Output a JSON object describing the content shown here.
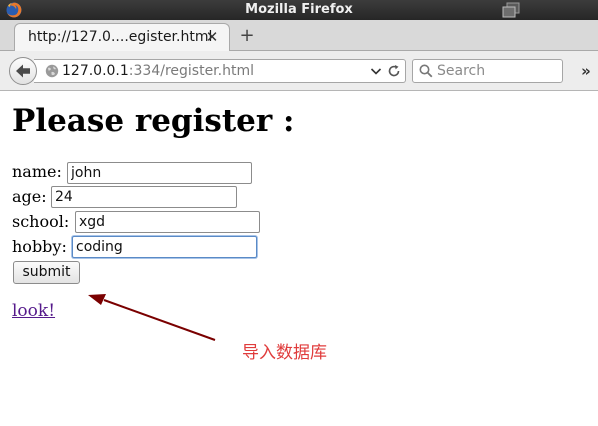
{
  "window": {
    "title": "Mozilla Firefox"
  },
  "tab": {
    "label": "http://127.0....egister.html",
    "close_glyph": "✕",
    "new_tab_glyph": "+"
  },
  "navbar": {
    "url_host": "127.0.0.1",
    "url_rest": ":334/register.html",
    "search_placeholder": "Search",
    "overflow_glyph": "»"
  },
  "page": {
    "heading": "Please register :",
    "form": {
      "name": {
        "label": "name:",
        "value": "john"
      },
      "age": {
        "label": "age:",
        "value": "24"
      },
      "school": {
        "label": "school:",
        "value": "xgd"
      },
      "hobby": {
        "label": "hobby:",
        "value": "coding"
      },
      "submit_label": "submit"
    },
    "link": "look!",
    "annotation": {
      "text": "导入数据库",
      "color": "#e03c3c",
      "arrow_color": "#7a0000"
    }
  },
  "icons": {
    "app": "firefox-icon",
    "restore": "restore-window-icon",
    "back": "back-arrow-icon",
    "site": "globe-icon",
    "dropdown": "chevron-down-icon",
    "reload": "reload-icon",
    "search": "search-icon"
  }
}
